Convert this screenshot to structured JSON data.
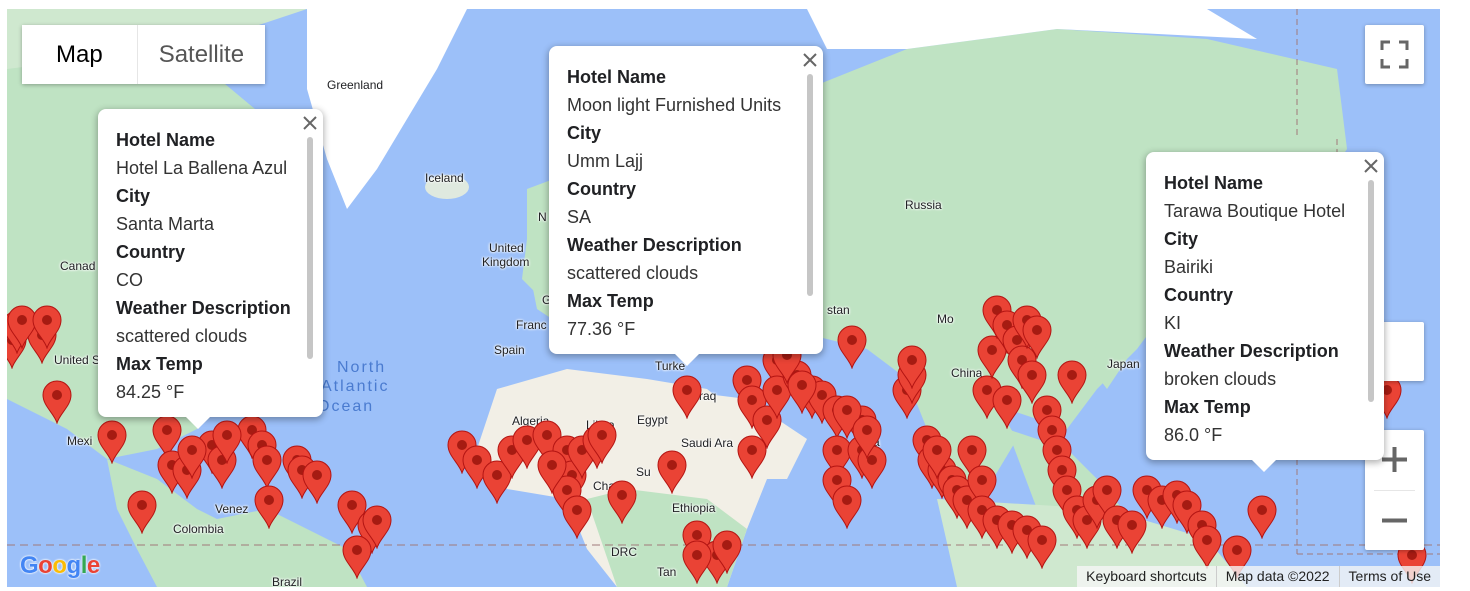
{
  "map_type_control": {
    "map_label": "Map",
    "satellite_label": "Satellite"
  },
  "place_labels": {
    "greenland": "Greenland",
    "iceland": "Iceland",
    "russia": "Russia",
    "canada": "Canad",
    "united_states": "United S",
    "mexico": "Mexi",
    "united_kingdom_1": "United",
    "united_kingdom_2": "Kingdom",
    "france": "Franc",
    "spain": "Spain",
    "algeria": "Algeria",
    "libya": "Libya",
    "egypt": "Egypt",
    "saudi": "Saudi Ara",
    "iraq": "raq",
    "turkey": "Turke",
    "chad": "Chad",
    "sudan": "Su",
    "ethiopia": "Ethiopia",
    "drc": "DRC",
    "tanzania": "Tan",
    "venezuela": "Venez",
    "colombia": "Colombia",
    "brazil": "Brazil",
    "mongolia": "Mo",
    "china": "China",
    "japan": "Japan",
    "kazakhstan": "stan",
    "north_a": "N",
    "g_label": "G",
    "a_label": "a",
    "ocean_1": "North",
    "ocean_2": "Atlantic",
    "ocean_3": "Ocean"
  },
  "info_windows": [
    {
      "hotel_name_label": "Hotel Name",
      "hotel_name": "Hotel La Ballena Azul",
      "city_label": "City",
      "city": "Santa Marta",
      "country_label": "Country",
      "country": "CO",
      "weather_label": "Weather Description",
      "weather": "scattered clouds",
      "max_temp_label": "Max Temp",
      "max_temp": "84.25 °F"
    },
    {
      "hotel_name_label": "Hotel Name",
      "hotel_name": "Moon light Furnished Units",
      "city_label": "City",
      "city": "Umm Lajj",
      "country_label": "Country",
      "country": "SA",
      "weather_label": "Weather Description",
      "weather": "scattered clouds",
      "max_temp_label": "Max Temp",
      "max_temp": "77.36 °F"
    },
    {
      "hotel_name_label": "Hotel Name",
      "hotel_name": "Tarawa Boutique Hotel",
      "city_label": "City",
      "city": "Bairiki",
      "country_label": "Country",
      "country": "KI",
      "weather_label": "Weather Description",
      "weather": "broken clouds",
      "max_temp_label": "Max Temp",
      "max_temp": "86.0 °F"
    }
  ],
  "attribution": {
    "keyboard_shortcuts": "Keyboard shortcuts",
    "map_data": "Map data ©2022",
    "terms": "Terms of Use"
  },
  "logo_text": "Google",
  "colors": {
    "water": "#9cc0f9",
    "land": "#bfe3c3",
    "desert": "#f2efe6",
    "marker": "#ea4335",
    "marker_dot": "#a61b12",
    "ice": "#ffffff"
  },
  "icons": {
    "fullscreen": "fullscreen-icon",
    "zoom_in": "plus-icon",
    "zoom_out": "minus-icon",
    "close": "close-icon",
    "marker": "map-pin-icon"
  }
}
